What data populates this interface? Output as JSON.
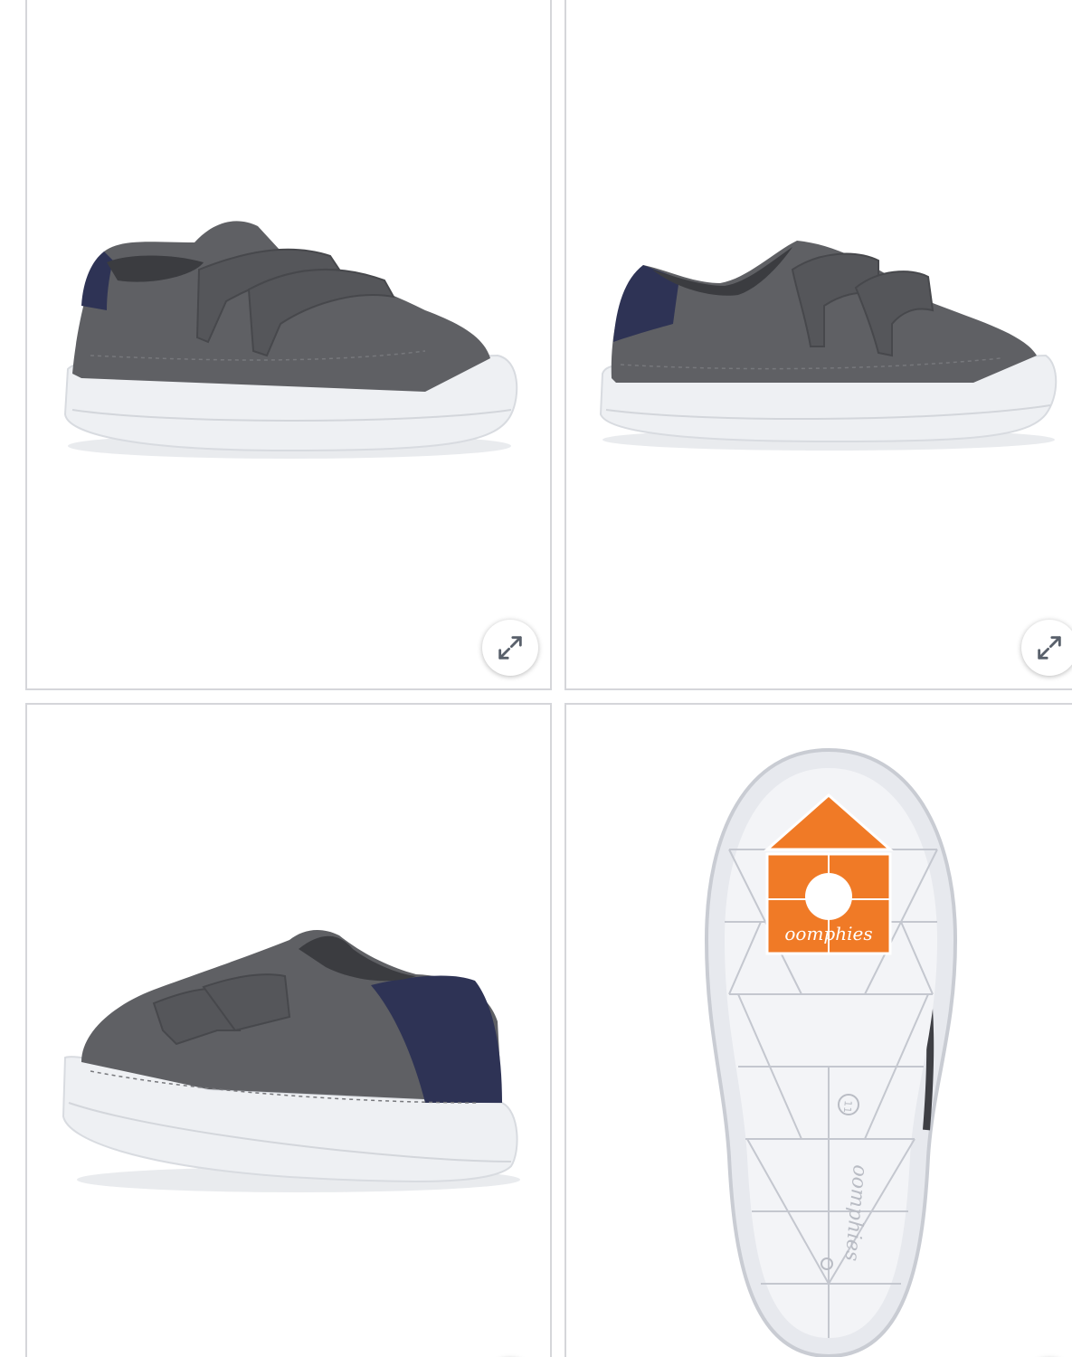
{
  "gallery": {
    "images": [
      {
        "name": "shoe-angled-front-view",
        "icon": "expand-icon"
      },
      {
        "name": "shoe-side-view",
        "icon": "expand-icon"
      },
      {
        "name": "shoe-angled-back-view",
        "icon": "expand-icon"
      },
      {
        "name": "shoe-sole-view",
        "icon": "expand-icon"
      }
    ],
    "sole_brand_text": "oomphies",
    "sole_heel_brand_text": "oomphies",
    "sole_size_text": "11"
  },
  "colors": {
    "tile_border": "#d5d6da",
    "shoe_upper": "#5f6064",
    "heel_tab": "#2e3355",
    "sole_white": "#eef0f3",
    "logo_orange": "#f07a26",
    "icon_gray": "#59606b"
  }
}
